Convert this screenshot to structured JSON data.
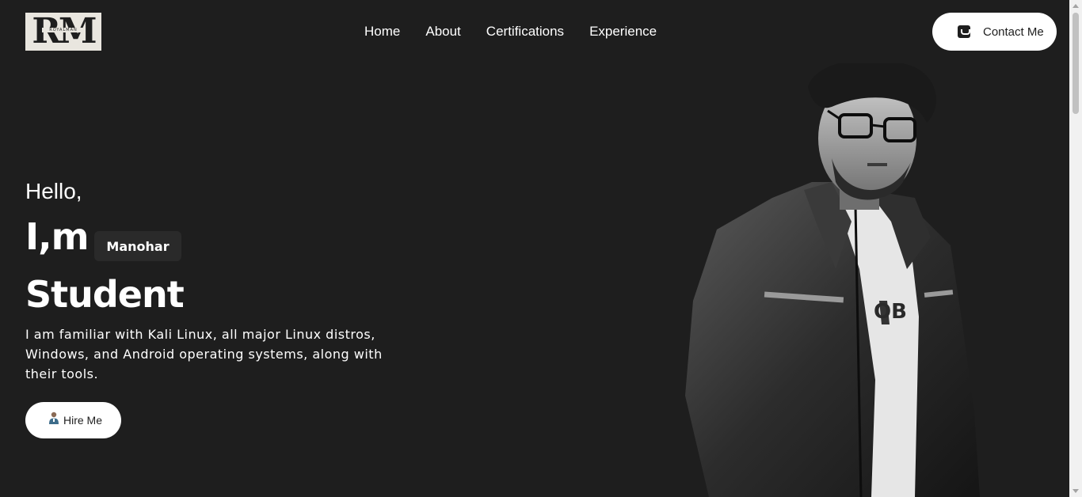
{
  "header": {
    "logo_text": "RM",
    "logo_subtext": "ROYALMAN",
    "nav": [
      "Home",
      "About",
      "Certifications",
      "Experience"
    ],
    "contact_label": "Contact Me"
  },
  "hero": {
    "greeting": "Hello,",
    "intro": "I,m",
    "name": "Manohar",
    "role": "Student",
    "description": "I am familiar with Kali Linux, all major Linux distros, Windows, and Android operating systems, along with their tools.",
    "hire_label": "Hire Me"
  },
  "colors": {
    "background": "#1e1e1e",
    "badge": "#2a2a2a",
    "button": "#ffffff"
  },
  "icons": {
    "contact": "chat-icon",
    "hire": "person-icon"
  }
}
